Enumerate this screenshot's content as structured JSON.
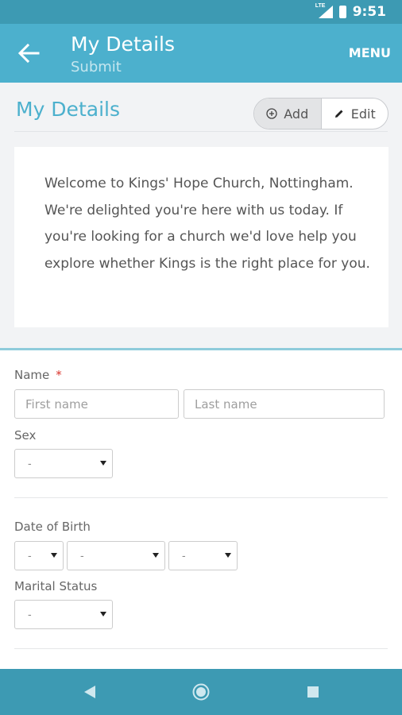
{
  "status_bar": {
    "time": "9:51",
    "network": "LTE"
  },
  "header": {
    "title": "My Details",
    "subtitle": "Submit",
    "menu_label": "MENU"
  },
  "page": {
    "title": "My Details",
    "add_label": "Add",
    "edit_label": "Edit"
  },
  "welcome": {
    "text": "Welcome to Kings' Hope Church, Nottingham. We're delighted you're here with us today. If you're looking for a church we'd love help you explore whether Kings is the right place for you."
  },
  "form": {
    "name_label": "Name",
    "required_marker": "*",
    "first_name_placeholder": "First name",
    "last_name_placeholder": "Last name",
    "sex_label": "Sex",
    "sex_value": "-",
    "dob_label": "Date of Birth",
    "dob_day_value": "-",
    "dob_month_value": "-",
    "dob_year_value": "-",
    "marital_label": "Marital Status",
    "marital_value": "-"
  },
  "colors": {
    "accent": "#4cb0cd",
    "status_bar": "#3d9ab3",
    "required": "#d9342b"
  }
}
